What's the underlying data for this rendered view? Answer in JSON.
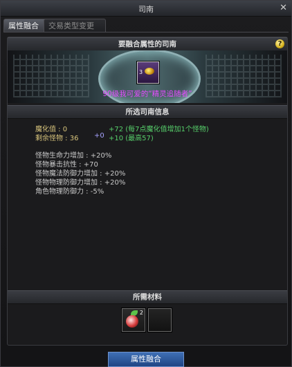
{
  "window": {
    "title": "司南"
  },
  "tabs": [
    {
      "label": "属性融合"
    },
    {
      "label": "交易类型变更"
    }
  ],
  "sections": {
    "target_header": "要融合属性的司南",
    "info_header": "所选司南信息",
    "materials_header": "所需材料"
  },
  "item": {
    "name": "90级我可爱的“精灵追随者”",
    "slot_badge": "3"
  },
  "stats": {
    "magic_label": "魔化值 : 0",
    "magic_gain": "+72 (每7点魔化值增加1个怪物)",
    "monsters_label": "剩余怪物 : 36",
    "monsters_bonus": "+0",
    "monsters_gain": "+10 (最高57)"
  },
  "effects": [
    "怪物生命力增加 : +20%",
    "怪物暴击抗性 : +70",
    "怪物魔法防御力增加 : +20%",
    "怪物物理防御力增加 : +20%",
    "角色物理防御力 : -5%"
  ],
  "materials": [
    {
      "quantity": "2"
    },
    {
      "quantity": ""
    }
  ],
  "button": {
    "label": "属性融合"
  },
  "icons": {
    "close": "close-icon",
    "help": "help-icon"
  },
  "colors": {
    "item_name": "#e54cff",
    "gain": "#57d06b",
    "bonus": "#a6a2ff",
    "label": "#d8c47c",
    "button": "#2f5aa0"
  }
}
